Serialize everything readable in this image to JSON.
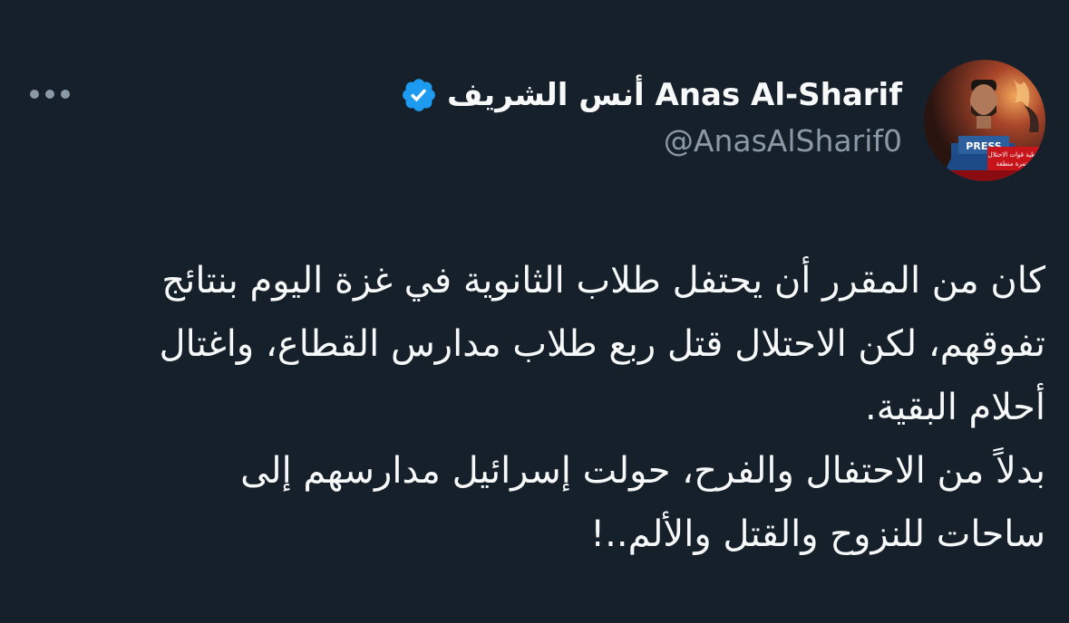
{
  "author": {
    "display_name": "أنس الشريف Anas Al-Sharif",
    "handle": "@AnasAlSharif0",
    "verified": true,
    "verified_icon": "verified-badge-icon",
    "avatar_text": {
      "press": "PRESS",
      "banner_line_1": "التغطية قوات الاحتلال",
      "banner_line_2": "مستمرة منطقة"
    }
  },
  "actions": {
    "more_icon": "more-horizontal-icon"
  },
  "tweet": {
    "lines": [
      "كان من المقرر أن يحتفل طلاب الثانوية في غزة اليوم بنتائج",
      "تفوقهم، لكن الاحتلال قتل ربع طلاب مدارس القطاع، واغتال",
      "أحلام البقية.",
      "بدلاً من الاحتفال والفرح، حولت إسرائيل مدارسهم إلى",
      "ساحات للنزوح والقتل والألم..!"
    ]
  },
  "colors": {
    "background": "#15202b",
    "text_primary": "#f7f9f9",
    "text_secondary": "#8b98a5",
    "verified_blue": "#1d9bf0"
  }
}
